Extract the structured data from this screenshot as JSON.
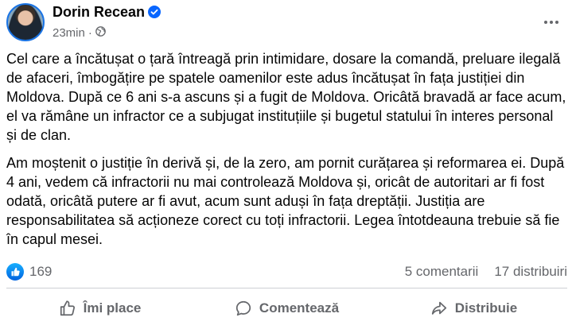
{
  "post": {
    "author": "Dorin Recean",
    "time": "23min",
    "paragraphs": [
      "Cel care a încătușat o țară întreagă prin intimidare, dosare la comandă, preluare ilegală de afaceri, îmbogățire pe spatele oamenilor este adus încătușat în fața justiției din Moldova. După ce 6 ani s-a ascuns și a fugit de Moldova. Oricâtă bravadă ar face acum, el va rămâne un infractor ce a subjugat instituțiile și bugetul statului în interes personal și de clan.",
      "Am moștenit o justiție în derivă și, de la zero, am pornit curățarea și reformarea ei. După 4 ani, vedem că infractorii nu mai controlează Moldova și, oricât de autoritari ar fi fost odată, oricâtă putere ar fi avut, acum sunt aduși în fața dreptății. Justiția are responsabilitatea să acționeze corect cu toți infractorii. Legea întotdeauna trebuie să fie în capul mesei."
    ]
  },
  "stats": {
    "reactions": "169",
    "comments": "5 comentarii",
    "shares": "17 distribuiri"
  },
  "actions": {
    "like": "Îmi place",
    "comment": "Comentează",
    "share": "Distribuie"
  },
  "icons": {
    "verified": "verified-badge-icon",
    "privacy": "globe-icon",
    "more": "more-options-icon",
    "reaction": "like-reaction-icon"
  },
  "colors": {
    "accent": "#0866ff",
    "secondary_text": "#65676b"
  }
}
